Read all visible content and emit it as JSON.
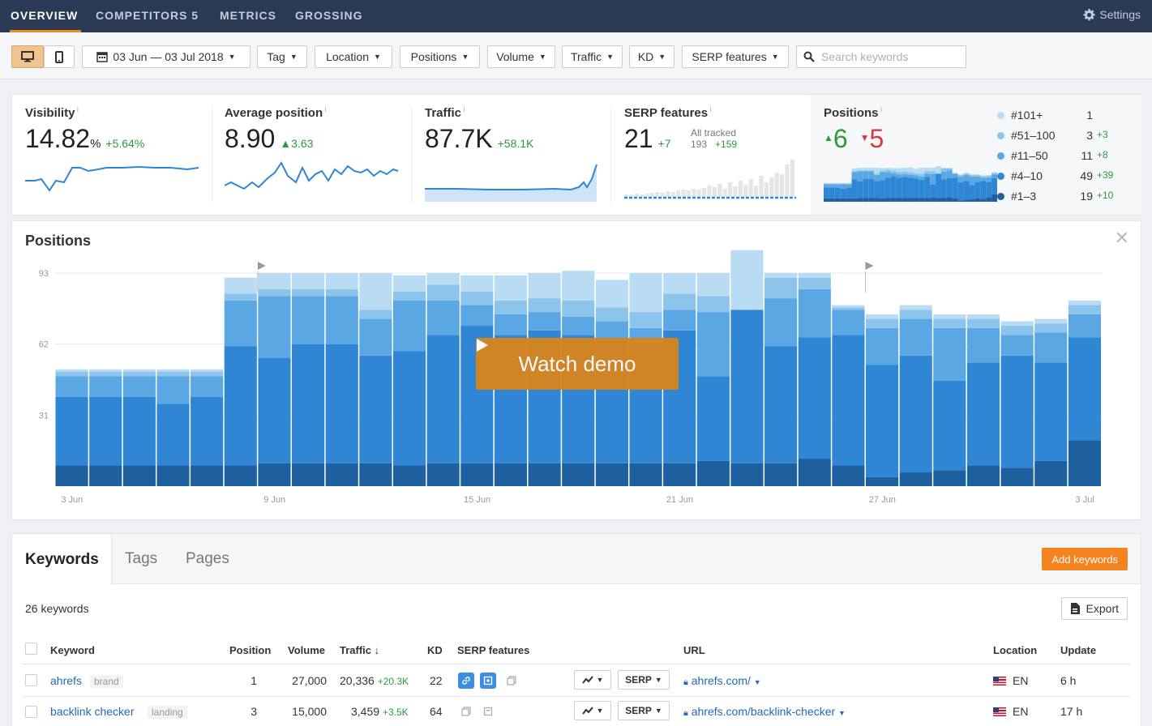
{
  "topnav": {
    "tabs": [
      {
        "label": "OVERVIEW",
        "active": true
      },
      {
        "label": "COMPETITORS 5",
        "active": false
      },
      {
        "label": "METRICS",
        "active": false
      },
      {
        "label": "GROSSING",
        "active": false
      }
    ],
    "settings_label": "Settings"
  },
  "toolbar": {
    "date_range": "03 Jun — 03 Jul 2018",
    "filters": [
      "Tag",
      "Location",
      "Positions",
      "Volume",
      "Traffic",
      "KD",
      "SERP features"
    ],
    "search_placeholder": "Search keywords"
  },
  "metrics": {
    "visibility": {
      "label": "Visibility",
      "value": "14.82",
      "unit": "%",
      "delta": "+5.64%"
    },
    "avg_position": {
      "label": "Average position",
      "value": "8.90",
      "delta": "3.63"
    },
    "traffic": {
      "label": "Traffic",
      "value": "87.7K",
      "delta": "+58.1K"
    },
    "serp": {
      "label": "SERP features",
      "value": "21",
      "delta": "+7",
      "all_tracked_label": "All tracked",
      "all_tracked_value": "193",
      "all_tracked_delta": "+159"
    },
    "positions": {
      "label": "Positions",
      "up": "6",
      "down": "5",
      "legend": [
        {
          "range": "#101+",
          "count": "1",
          "delta": "",
          "color": "#b9dcf3"
        },
        {
          "range": "#51–100",
          "count": "3",
          "delta": "+3",
          "color": "#8cc4ec"
        },
        {
          "range": "#11–50",
          "count": "11",
          "delta": "+8",
          "color": "#5aa7e3"
        },
        {
          "range": "#4–10",
          "count": "49",
          "delta": "+39",
          "color": "#2f86d4"
        },
        {
          "range": "#1–3",
          "count": "19",
          "delta": "+10",
          "color": "#1e5f9e"
        }
      ]
    }
  },
  "positions_chart": {
    "title": "Positions",
    "demo_label": "Watch demo"
  },
  "chart_data": {
    "type": "bar",
    "stacked": true,
    "yticks": [
      31,
      62,
      93
    ],
    "ylim": [
      0,
      93
    ],
    "xtick_labels": [
      "3 Jun",
      "9 Jun",
      "15 Jun",
      "21 Jun",
      "27 Jun",
      "3 Jul"
    ],
    "categories": [
      "3 Jun",
      "4 Jun",
      "5 Jun",
      "6 Jun",
      "7 Jun",
      "8 Jun",
      "9 Jun",
      "10 Jun",
      "11 Jun",
      "12 Jun",
      "13 Jun",
      "14 Jun",
      "15 Jun",
      "16 Jun",
      "17 Jun",
      "18 Jun",
      "19 Jun",
      "20 Jun",
      "21 Jun",
      "22 Jun",
      "23 Jun",
      "24 Jun",
      "25 Jun",
      "26 Jun",
      "27 Jun",
      "28 Jun",
      "29 Jun",
      "30 Jun",
      "1 Jul",
      "2 Jul",
      "3 Jul"
    ],
    "series": [
      {
        "name": "#1–3",
        "color": "#1e5f9e",
        "values": [
          9,
          9,
          9,
          9,
          9,
          9,
          10,
          10,
          10,
          10,
          9,
          10,
          10,
          10,
          10,
          10,
          10,
          10,
          10,
          11,
          10,
          10,
          12,
          9,
          4,
          6,
          7,
          9,
          8,
          11,
          20
        ]
      },
      {
        "name": "#4–10",
        "color": "#2f86d4",
        "values": [
          30,
          30,
          30,
          27,
          30,
          52,
          46,
          52,
          52,
          47,
          50,
          56,
          60,
          56,
          58,
          56,
          54,
          50,
          58,
          37,
          67,
          51,
          53,
          57,
          49,
          51,
          39,
          45,
          49,
          43,
          45
        ]
      },
      {
        "name": "#11–50",
        "color": "#5aa7e3",
        "values": [
          9,
          9,
          9,
          12,
          9,
          20,
          27,
          21,
          21,
          16,
          22,
          15,
          9,
          9,
          8,
          8,
          8,
          9,
          9,
          28,
          0,
          21,
          21,
          11,
          16,
          16,
          23,
          15,
          9,
          13,
          10
        ]
      },
      {
        "name": "#51–100",
        "color": "#8cc4ec",
        "values": [
          2,
          2,
          2,
          2,
          2,
          3,
          3,
          3,
          3,
          4,
          4,
          7,
          6,
          6,
          6,
          7,
          6,
          7,
          7,
          7,
          0,
          9,
          5,
          1,
          4,
          4,
          4,
          4,
          4,
          4,
          4
        ]
      },
      {
        "name": "#101+",
        "color": "#b9dcf3",
        "values": [
          1,
          1,
          1,
          1,
          1,
          7,
          7,
          7,
          7,
          16,
          7,
          5,
          7,
          11,
          11,
          13,
          12,
          17,
          9,
          10,
          26,
          2,
          2,
          1,
          2,
          2,
          2,
          2,
          2,
          2,
          2
        ]
      }
    ],
    "markers": [
      "9 Jun",
      "27 Jun"
    ]
  },
  "keywords_panel": {
    "tabs": [
      {
        "label": "Keywords",
        "active": true
      },
      {
        "label": "Tags",
        "active": false
      },
      {
        "label": "Pages",
        "active": false
      }
    ],
    "add_button": "Add keywords",
    "count_label": "26 keywords",
    "export_label": "Export",
    "columns": {
      "keyword": "Keyword",
      "position": "Position",
      "volume": "Volume",
      "traffic": "Traffic",
      "kd": "KD",
      "serp": "SERP features",
      "url": "URL",
      "location": "Location",
      "update": "Update"
    },
    "rows": [
      {
        "keyword": "ahrefs",
        "tag": "brand",
        "position": "1",
        "volume": "27,000",
        "traffic": "20,336",
        "traffic_delta": "+20.3K",
        "kd": "22",
        "serp_button": "SERP",
        "url": "ahrefs.com/",
        "location": "EN",
        "update": "6 h"
      },
      {
        "keyword": "backlink checker",
        "tag": "landing",
        "position": "3",
        "volume": "15,000",
        "traffic": "3,459",
        "traffic_delta": "+3.5K",
        "kd": "64",
        "serp_button": "SERP",
        "url": "ahrefs.com/backlink-checker",
        "location": "EN",
        "update": "17 h"
      }
    ]
  }
}
